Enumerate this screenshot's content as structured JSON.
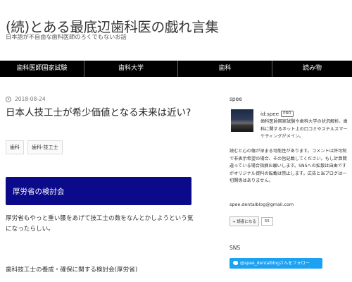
{
  "header": {
    "title": "(続)とある最底辺歯科医の戯れ言集",
    "description": "日本語が不自由な歯科医師のろくでもないお話"
  },
  "nav": {
    "items": [
      {
        "label": "歯科医師国家試験"
      },
      {
        "label": "歯科大学"
      },
      {
        "label": "歯科"
      },
      {
        "label": "読み物"
      }
    ]
  },
  "entry": {
    "date": "2018-08-24",
    "title": "日本人技工士が希少価値となる未来は近い?",
    "categories": [
      "歯科",
      "歯科-技工士"
    ],
    "heading": "厚労省の検討会",
    "paragraph": "厚労省もやっと重い腰をあげて技工士の数をなんとかしようという気になったらしい。",
    "subheading": "歯科技工士の養成・確保に関する検討会(厚労省)"
  },
  "sidebar": {
    "profile_title": "spee",
    "id_label": "id:spee",
    "pro_badge": "PRO",
    "profile_text_1": "歯科医師国家試験や歯科大学の状況解析、歯科に関するネット上の口コミやステルスマーケティングがメイン。",
    "profile_text_2": "読むと心の傷が深まる可能性があります。コメントは許可制で非表示希望の場合、その旨記載してください。もし計算間違っている場合指摘お願いします。SNSへの拡散は自由ですがオリジナル資料の転載は禁止します。広告と当ブログは一切関係はありません。",
    "email": "spee.dentalblog@gmail.com",
    "reader_button": "+ 読者になる",
    "reader_count": "55",
    "sns_title": "SNS",
    "twitter_button": "@spee_dentalblogさんをフォロー"
  },
  "colors": {
    "nav_bg": "#000000",
    "heading_box": "#0a0a8a",
    "twitter": "#1da1f2"
  }
}
